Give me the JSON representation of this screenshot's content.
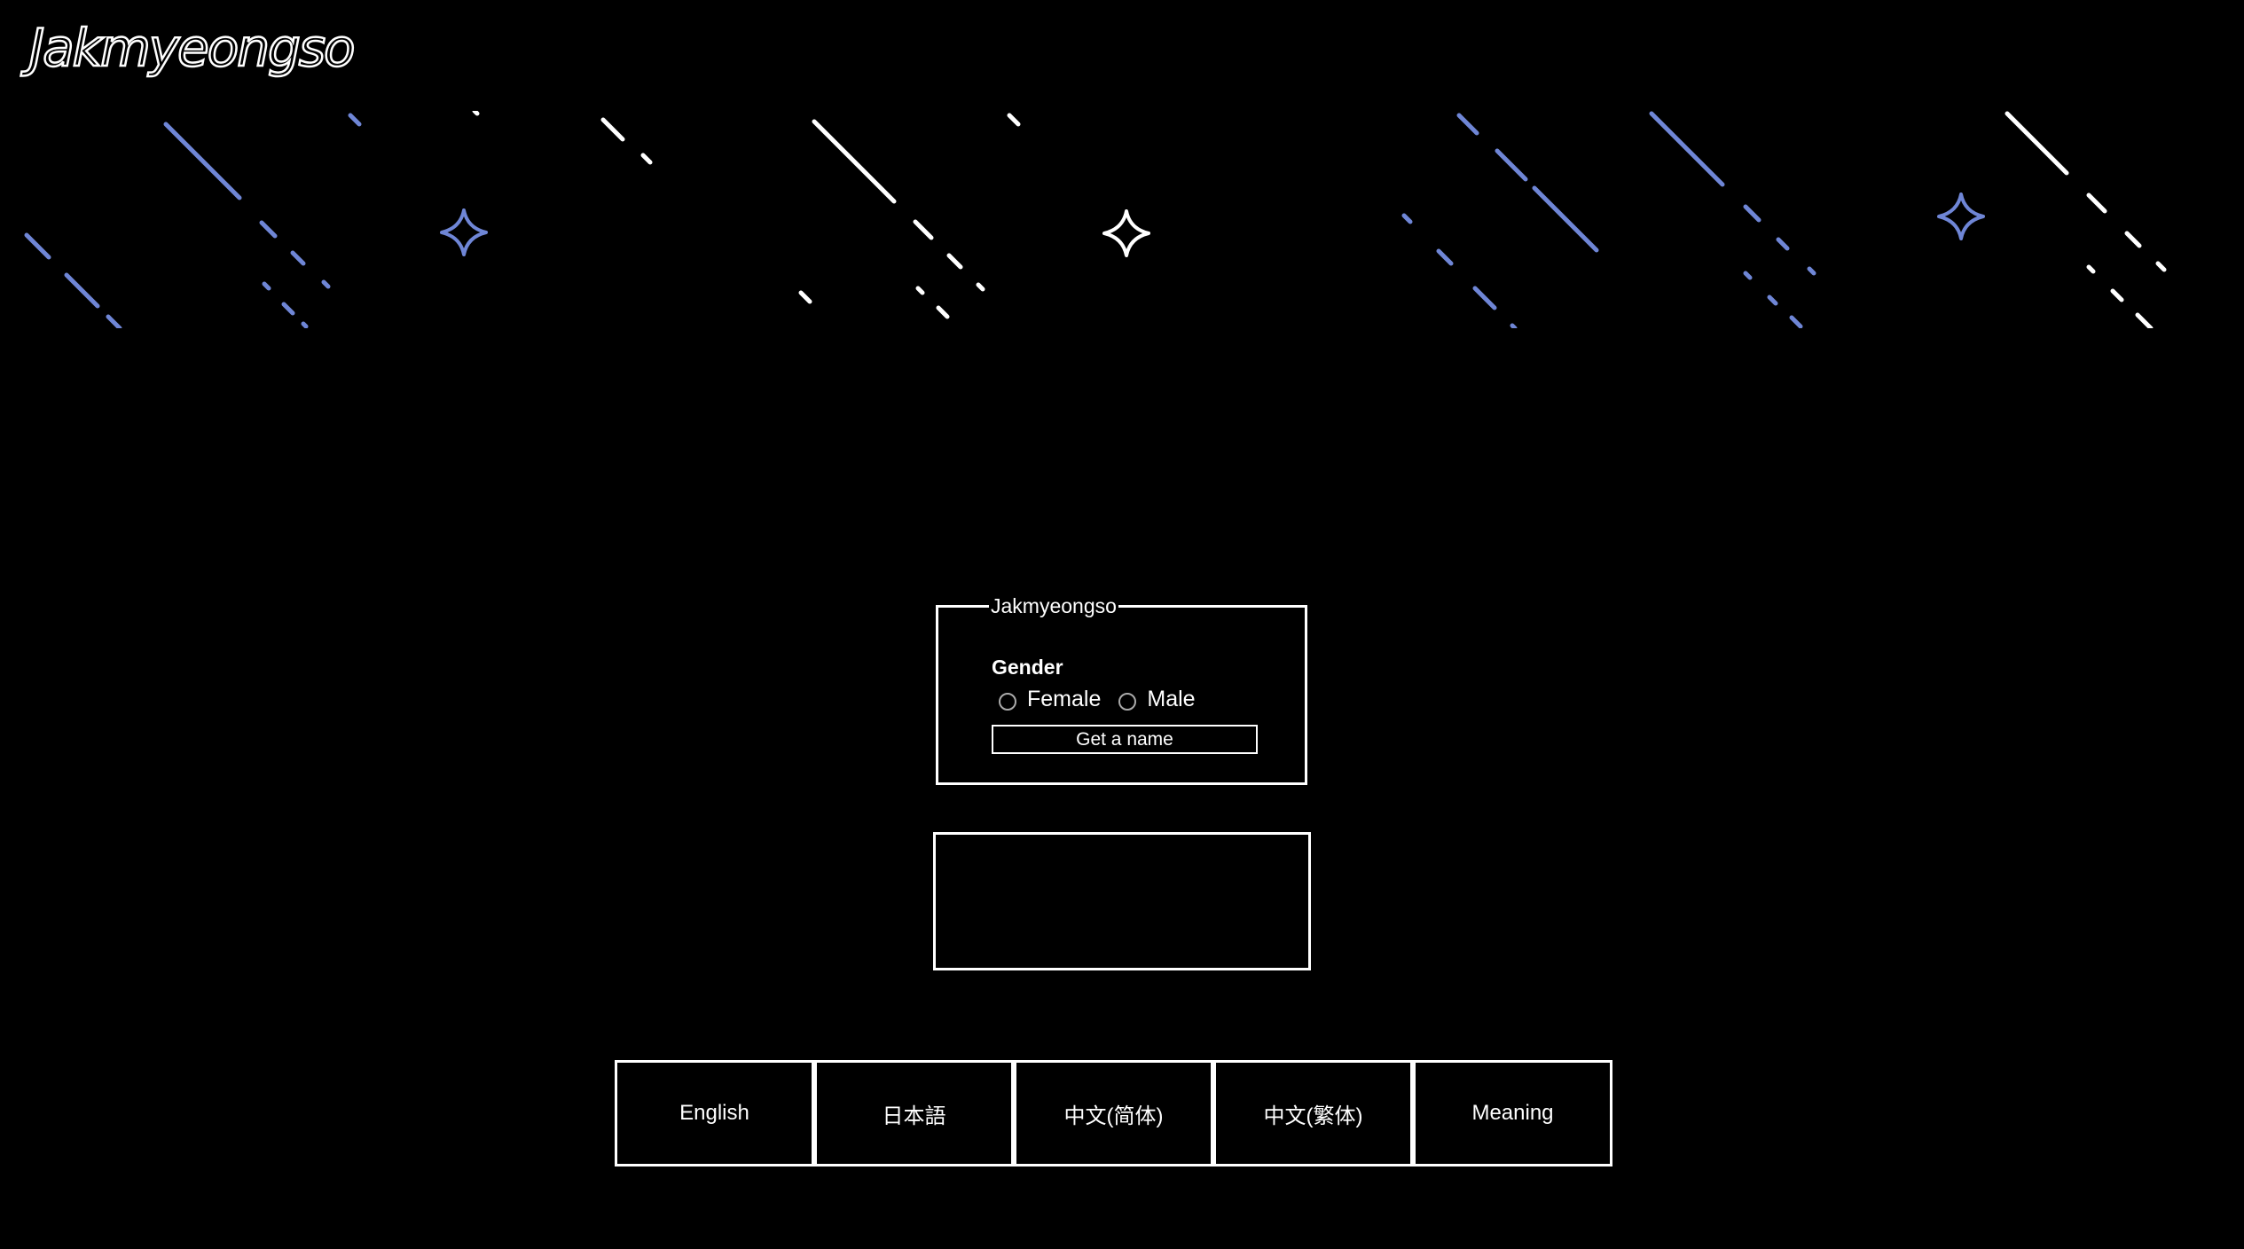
{
  "header": {
    "logo_text": "Jakmyeongso"
  },
  "form": {
    "legend": "Jakmyeongso",
    "gender_label": "Gender",
    "options": [
      {
        "label": "Female"
      },
      {
        "label": "Male"
      }
    ],
    "submit_label": "Get a name"
  },
  "result": {
    "text": ""
  },
  "tabs": [
    {
      "label": "English"
    },
    {
      "label": "日本語"
    },
    {
      "label": "中文(简体)"
    },
    {
      "label": "中文(繁体)"
    },
    {
      "label": "Meaning"
    }
  ],
  "colors": {
    "background": "#000000",
    "foreground": "#ffffff",
    "accent": "#6f86d6"
  },
  "decorations": {
    "icons": [
      "sparkle-icon",
      "meteor-streak"
    ]
  }
}
